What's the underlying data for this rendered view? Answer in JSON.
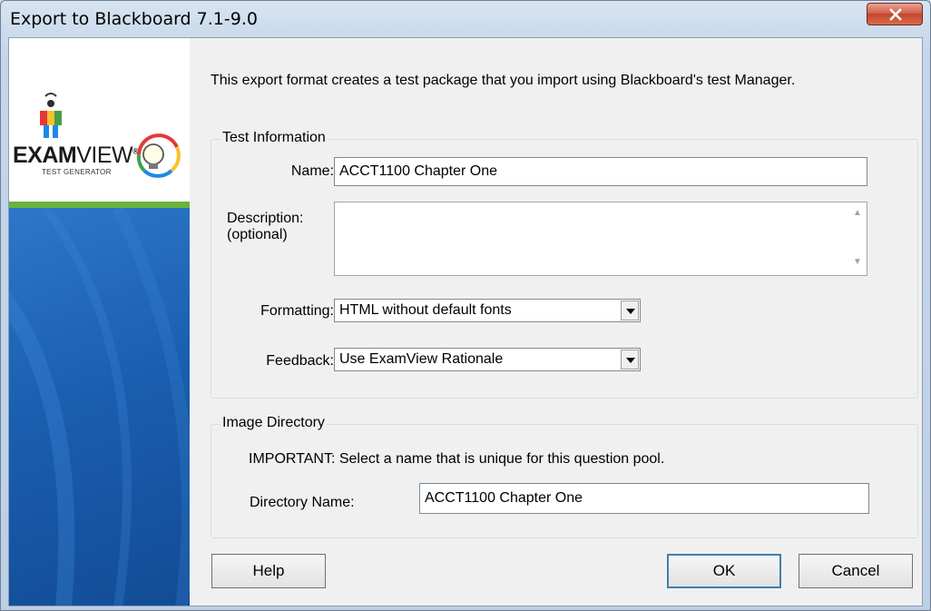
{
  "window": {
    "title": "Export to Blackboard 7.1-9.0"
  },
  "brand": {
    "logo_text_bold": "EXAM",
    "logo_text_thin": "VIEW",
    "logo_sub": "TEST GENERATOR",
    "logo_reg": "®"
  },
  "intro": "This export format creates a test package that you import using Blackboard's test Manager.",
  "test_info": {
    "legend": "Test Information",
    "name_label": "Name:",
    "name_value": "ACCT1100 Chapter One",
    "description_label_1": "Description:",
    "description_label_2": "(optional)",
    "description_value": "",
    "formatting_label": "Formatting:",
    "formatting_value": "HTML without default fonts",
    "feedback_label": "Feedback:",
    "feedback_value": "Use ExamView Rationale"
  },
  "image_dir": {
    "legend": "Image Directory",
    "notice": "IMPORTANT: Select a name that is unique for this question pool.",
    "dir_label": "Directory Name:",
    "dir_value": "ACCT1100 Chapter One"
  },
  "buttons": {
    "help": "Help",
    "ok": "OK",
    "cancel": "Cancel"
  },
  "colors": {
    "brand_blue": "#1c63b5",
    "brand_green": "#6bb43c",
    "close_red": "#c3452d"
  }
}
